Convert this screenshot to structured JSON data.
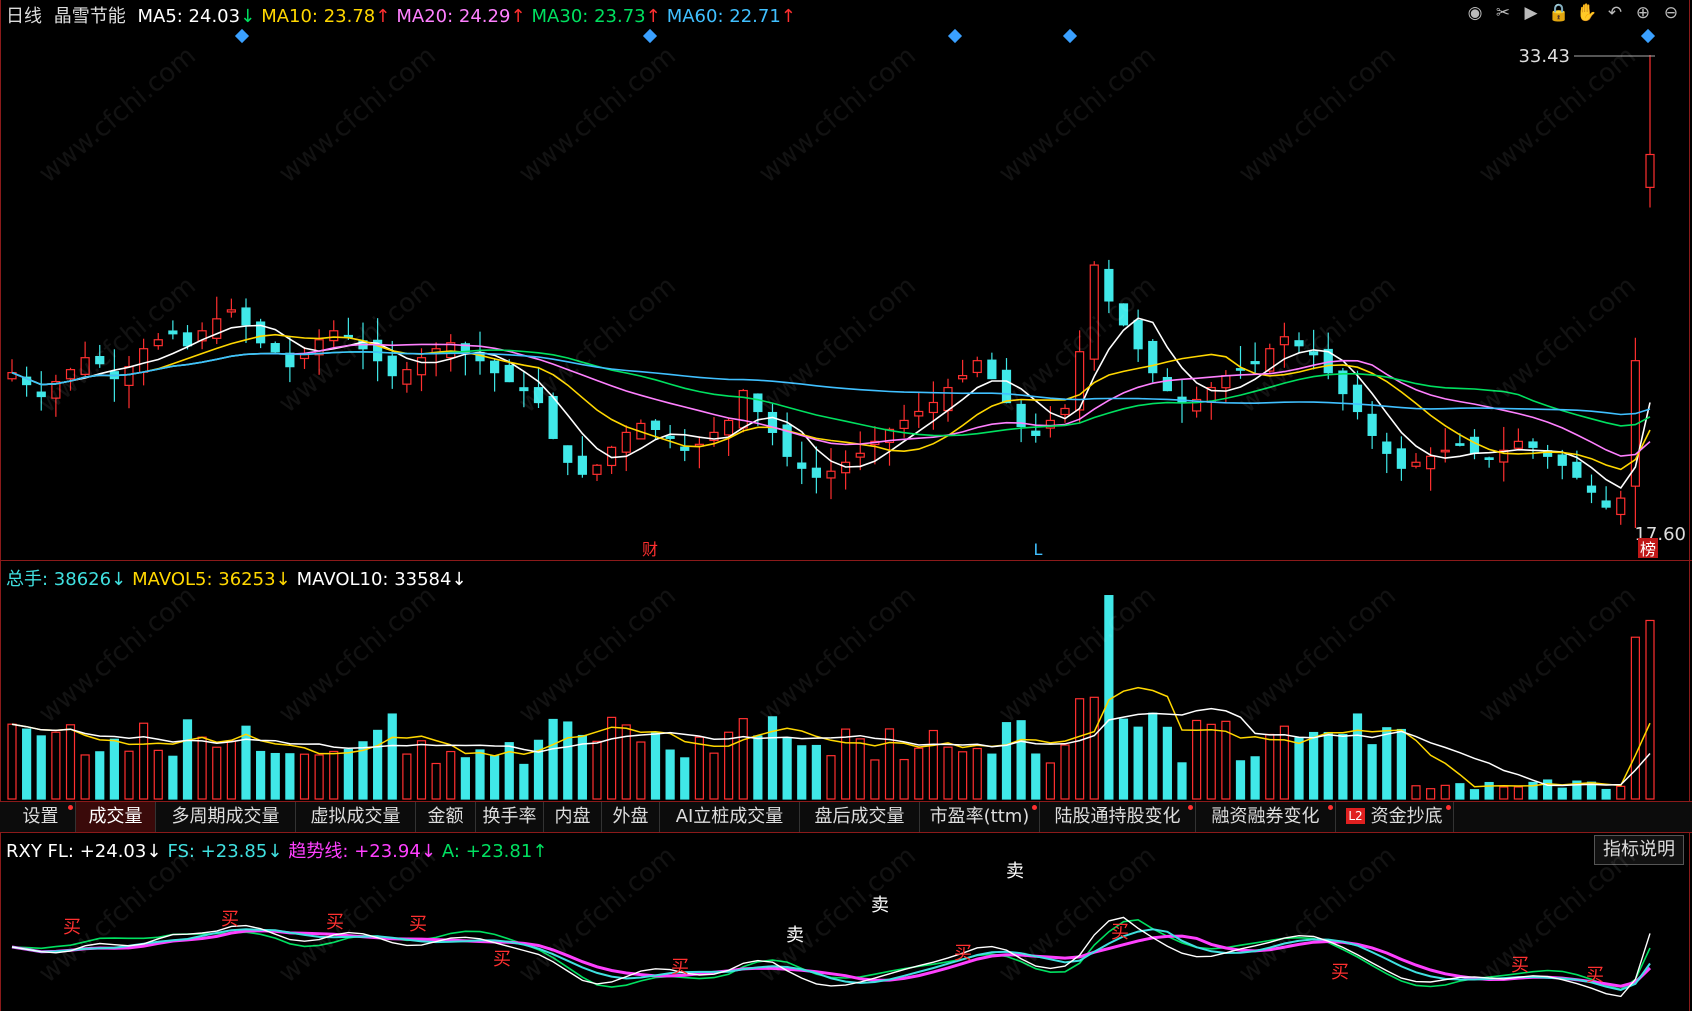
{
  "header": {
    "period": "日线",
    "stock": "晶雪节能",
    "ma": [
      {
        "label": "MA5: 24.03",
        "arrow": "↓",
        "color": "#ffffff",
        "arrowColor": "#00e060"
      },
      {
        "label": "MA10: 23.78",
        "arrow": "↑",
        "color": "#ffd700",
        "arrowColor": "#ff3030"
      },
      {
        "label": "MA20: 24.29",
        "arrow": "↑",
        "color": "#ff80ff",
        "arrowColor": "#ff3030"
      },
      {
        "label": "MA30: 23.73",
        "arrow": "↑",
        "color": "#00e060",
        "arrowColor": "#ff3030"
      },
      {
        "label": "MA60: 22.71",
        "arrow": "↑",
        "color": "#40c0ff",
        "arrowColor": "#ff3030"
      }
    ]
  },
  "toolbar": [
    "eye-icon",
    "cut-icon",
    "play-icon",
    "lock-icon",
    "hand-icon",
    "undo-icon",
    "zoom-in-icon",
    "zoom-out-icon"
  ],
  "price_pane": {
    "high_label": "33.43",
    "low_label": "17.60",
    "markers": [
      "财",
      "L",
      "榜"
    ]
  },
  "volume_legend": [
    {
      "label": "总手: 38626",
      "arrow": "↓",
      "color": "#40e0e0"
    },
    {
      "label": "MAVOL5: 36253",
      "arrow": "↓",
      "color": "#ffd700"
    },
    {
      "label": "MAVOL10: 33584",
      "arrow": "↓",
      "color": "#ffffff"
    }
  ],
  "tabs": [
    {
      "label": "设置",
      "dot": true
    },
    {
      "label": "成交量",
      "dot": false,
      "active": true
    },
    {
      "label": "多周期成交量",
      "dot": false
    },
    {
      "label": "虚拟成交量",
      "dot": false
    },
    {
      "label": "金额",
      "dot": false
    },
    {
      "label": "换手率",
      "dot": false
    },
    {
      "label": "内盘",
      "dot": false
    },
    {
      "label": "外盘",
      "dot": false
    },
    {
      "label": "AI立桩成交量",
      "dot": false
    },
    {
      "label": "盘后成交量",
      "dot": false
    },
    {
      "label": "市盈率(ttm)",
      "dot": true
    },
    {
      "label": "陆股通持股变化",
      "dot": true
    },
    {
      "label": "融资融券变化",
      "dot": true
    },
    {
      "label": "资金抄底",
      "dot": true,
      "l2": "L2"
    }
  ],
  "indicator_legend": [
    {
      "label": "RXY FL: +24.03",
      "arrow": "↓",
      "color": "#ffffff"
    },
    {
      "label": "FS: +23.85",
      "arrow": "↓",
      "color": "#40e0e0"
    },
    {
      "label": "趋势线: +23.94",
      "arrow": "↓",
      "color": "#ff40ff"
    },
    {
      "label": "A: +23.81",
      "arrow": "↑",
      "color": "#00e060"
    }
  ],
  "indicator_button": "指标说明",
  "signals": {
    "buy": "买",
    "sell": "卖"
  },
  "watermark": "www.cfchi.com",
  "chart_data": {
    "type": "candlestick",
    "ylim": [
      17.6,
      33.43
    ],
    "candles_note": "values approximated from the visible candlestick chart",
    "closes": [
      22.8,
      22.4,
      22.0,
      22.5,
      22.9,
      23.3,
      23.1,
      22.6,
      23.0,
      23.6,
      23.9,
      24.1,
      23.7,
      24.2,
      24.6,
      24.9,
      24.4,
      23.8,
      23.5,
      23.0,
      23.4,
      23.9,
      24.2,
      24.0,
      23.6,
      23.2,
      22.7,
      22.9,
      23.3,
      23.6,
      23.8,
      23.5,
      23.2,
      22.8,
      22.5,
      22.2,
      21.8,
      20.6,
      19.8,
      19.4,
      19.7,
      20.3,
      20.8,
      21.1,
      20.9,
      20.6,
      20.2,
      20.4,
      20.8,
      21.2,
      22.2,
      21.5,
      20.8,
      20.0,
      19.6,
      19.3,
      19.5,
      19.8,
      20.1,
      20.5,
      20.9,
      21.2,
      21.5,
      21.8,
      22.3,
      22.7,
      23.2,
      22.6,
      21.8,
      21.0,
      20.7,
      21.2,
      21.6,
      23.5,
      26.4,
      25.2,
      24.4,
      23.6,
      22.8,
      22.2,
      21.8,
      21.9,
      22.3,
      22.7,
      22.9,
      23.1,
      23.6,
      24.0,
      23.7,
      23.4,
      22.8,
      22.1,
      21.5,
      20.7,
      20.1,
      19.6,
      19.8,
      20.0,
      20.2,
      20.4,
      20.1,
      19.9,
      20.2,
      20.5,
      20.3,
      20.0,
      19.7,
      19.3,
      18.8,
      18.3,
      18.6,
      23.2,
      30.1
    ]
  },
  "volume_data": {
    "ylim": [
      0,
      45000
    ],
    "note": "approximate"
  }
}
